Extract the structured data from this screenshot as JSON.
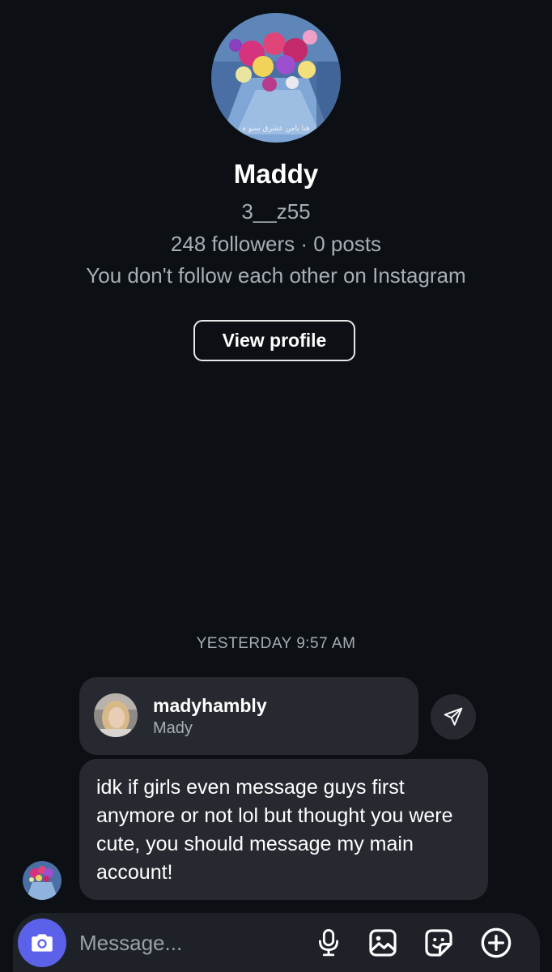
{
  "profile": {
    "avatar_icon": "flower-bouquet-photo",
    "avatar_caption": "هنا يامن عشرق ستو ه",
    "display_name": "Maddy",
    "username": "3__z55",
    "stats": "248 followers · 0 posts",
    "follow_note": "You don't follow each other on Instagram",
    "view_profile_label": "View profile"
  },
  "thread": {
    "timestamp": "YESTERDAY 9:57 AM",
    "shared_profile": {
      "username": "madyhambly",
      "name": "Mady",
      "avatar_icon": "woman-selfie-photo"
    },
    "share_icon": "paper-plane-icon",
    "message_text": "idk if girls even message guys first anymore or not lol but thought you were cute, you should message my main account!",
    "sender_avatar_icon": "flower-bouquet-photo"
  },
  "composer": {
    "placeholder": "Message...",
    "camera_icon": "camera-icon",
    "mic_icon": "microphone-icon",
    "gallery_icon": "image-icon",
    "sticker_icon": "sticker-icon",
    "more_icon": "plus-circle-icon"
  },
  "colors": {
    "background": "#0c0f14",
    "bubble": "#262a30",
    "secondary_text": "#a8adb5",
    "camera_accent": "#5b62e9"
  }
}
